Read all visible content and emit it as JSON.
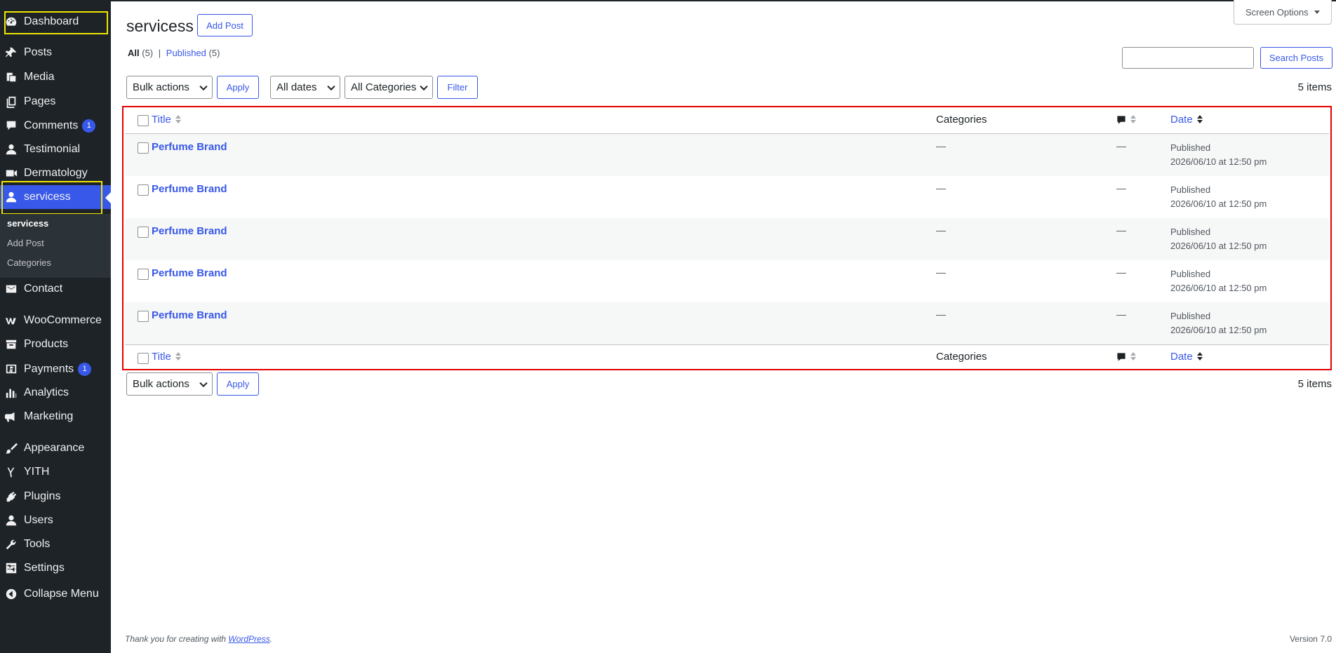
{
  "sidebar": {
    "items": [
      {
        "label": "Dashboard",
        "icon": "dashboard-icon"
      },
      {
        "label": "Posts",
        "icon": "pin-icon"
      },
      {
        "label": "Media",
        "icon": "media-icon"
      },
      {
        "label": "Pages",
        "icon": "pages-icon"
      },
      {
        "label": "Comments",
        "icon": "comment-icon",
        "badge": "1"
      },
      {
        "label": "Testimonial",
        "icon": "person-icon"
      },
      {
        "label": "Dermatology",
        "icon": "video-icon"
      },
      {
        "label": "servicess",
        "icon": "person-icon"
      },
      {
        "label": "Contact",
        "icon": "mail-icon"
      },
      {
        "label": "WooCommerce",
        "icon": "woo-icon"
      },
      {
        "label": "Products",
        "icon": "archive-icon"
      },
      {
        "label": "Payments",
        "icon": "dollar-icon",
        "badge": "1"
      },
      {
        "label": "Analytics",
        "icon": "chart-bar-icon"
      },
      {
        "label": "Marketing",
        "icon": "megaphone-icon"
      },
      {
        "label": "Appearance",
        "icon": "brush-icon"
      },
      {
        "label": "YITH",
        "icon": "yith-icon"
      },
      {
        "label": "Plugins",
        "icon": "plugin-icon"
      },
      {
        "label": "Users",
        "icon": "person-icon"
      },
      {
        "label": "Tools",
        "icon": "wrench-icon"
      },
      {
        "label": "Settings",
        "icon": "settings-icon"
      },
      {
        "label": "Collapse Menu",
        "icon": "collapse-icon"
      }
    ],
    "submenu": [
      {
        "label": "servicess"
      },
      {
        "label": "Add Post"
      },
      {
        "label": "Categories"
      }
    ]
  },
  "header": {
    "title": "servicess",
    "add_post_label": "Add Post",
    "screen_options_label": "Screen Options"
  },
  "views": {
    "all_label": "All",
    "all_count": "(5)",
    "separator": "|",
    "published_label": "Published",
    "published_count": "(5)"
  },
  "search": {
    "placeholder": "",
    "button_label": "Search Posts"
  },
  "toolbar": {
    "bulk_actions": "Bulk actions",
    "apply_label": "Apply",
    "dates_filter": "All dates",
    "categories_filter": "All Categories",
    "filter_label": "Filter",
    "items_count": "5 items"
  },
  "table": {
    "columns": {
      "title": "Title",
      "categories": "Categories",
      "date": "Date"
    },
    "rows": [
      {
        "title": "Perfume Brand",
        "categories": "—",
        "comments": "—",
        "status": "Published",
        "date": "2026/06/10 at 12:50 pm"
      },
      {
        "title": "Perfume Brand",
        "categories": "—",
        "comments": "—",
        "status": "Published",
        "date": "2026/06/10 at 12:50 pm"
      },
      {
        "title": "Perfume Brand",
        "categories": "—",
        "comments": "—",
        "status": "Published",
        "date": "2026/06/10 at 12:50 pm"
      },
      {
        "title": "Perfume Brand",
        "categories": "—",
        "comments": "—",
        "status": "Published",
        "date": "2026/06/10 at 12:50 pm"
      },
      {
        "title": "Perfume Brand",
        "categories": "—",
        "comments": "—",
        "status": "Published",
        "date": "2026/06/10 at 12:50 pm"
      }
    ]
  },
  "footer": {
    "thanks_prefix": "Thank you for creating with",
    "wordpress_link": "WordPress",
    "thanks_suffix": ".",
    "version": "Version 7.0"
  },
  "colors": {
    "accent": "#3858e9",
    "sidebar": "#1d2327",
    "highlight_red": "#e30000",
    "highlight_yellow": "#f0e500"
  }
}
